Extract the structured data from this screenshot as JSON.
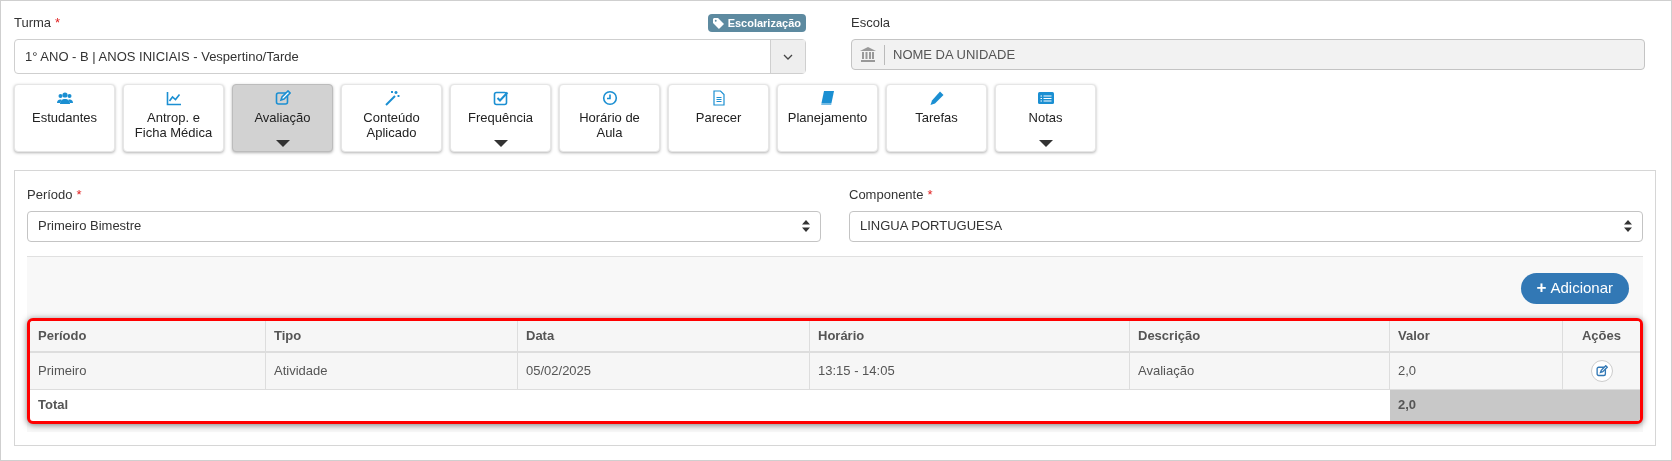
{
  "turma": {
    "label": "Turma",
    "required_mark": "*",
    "badge": "Escolarização",
    "value": "1° ANO - B | ANOS INICIAIS - Vespertino/Tarde"
  },
  "escola": {
    "label": "Escola",
    "value": "NOME DA UNIDADE"
  },
  "tabs": [
    {
      "label": "Estudantes",
      "kind": "users",
      "selected": false,
      "dropdown": false
    },
    {
      "label": "Antrop. e\nFicha Médica",
      "kind": "chart",
      "selected": false,
      "dropdown": false
    },
    {
      "label": "Avaliação",
      "kind": "edit",
      "selected": true,
      "dropdown": true
    },
    {
      "label": "Conteúdo\nAplicado",
      "kind": "wand",
      "selected": false,
      "dropdown": false
    },
    {
      "label": "Frequência",
      "kind": "check",
      "selected": false,
      "dropdown": true
    },
    {
      "label": "Horário de\nAula",
      "kind": "clock",
      "selected": false,
      "dropdown": false
    },
    {
      "label": "Parecer",
      "kind": "file",
      "selected": false,
      "dropdown": false
    },
    {
      "label": "Planejamento",
      "kind": "book",
      "selected": false,
      "dropdown": false
    },
    {
      "label": "Tarefas",
      "kind": "pencil",
      "selected": false,
      "dropdown": false
    },
    {
      "label": "Notas",
      "kind": "list",
      "selected": false,
      "dropdown": true
    }
  ],
  "periodo": {
    "label": "Período",
    "required_mark": "*",
    "value": "Primeiro Bimestre"
  },
  "componente": {
    "label": "Componente",
    "required_mark": "*",
    "value": "LINGUA PORTUGUESA"
  },
  "add_button": {
    "icon": "+",
    "label": "Adicionar"
  },
  "table": {
    "highlighted": true,
    "columns": [
      "Período",
      "Tipo",
      "Data",
      "Horário",
      "Descrição",
      "Valor",
      "Ações"
    ],
    "rows": [
      {
        "cells": [
          "Primeiro",
          "Atividade",
          "05/02/2025",
          "13:15 - 14:05",
          "Avaliação",
          "2,0"
        ]
      }
    ],
    "total": {
      "label": "Total",
      "value": "2,0"
    }
  }
}
